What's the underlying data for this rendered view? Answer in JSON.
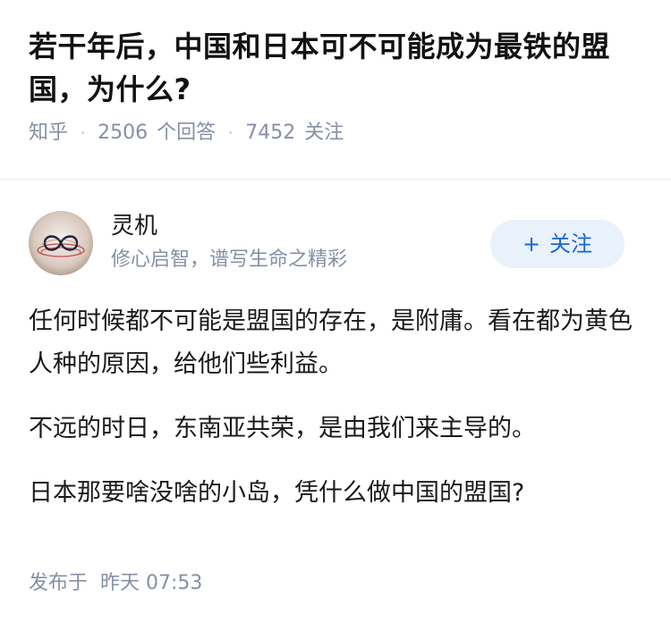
{
  "question": {
    "title": "若干年后，中国和日本可不可能成为最铁的盟国，为什么?",
    "source": "知乎",
    "answer_count": "2506",
    "answer_count_label": "个回答",
    "follow_count": "7452",
    "follow_count_label": "关注"
  },
  "author": {
    "name": "灵机",
    "bio": "修心启智，谱写生命之精彩",
    "avatar_icon": "infinity-logo-avatar",
    "follow_plus": "+",
    "follow_label": "关注"
  },
  "answer": {
    "paragraphs": [
      "任何时候都不可能是盟国的存在，是附庸。看在都为黄色人种的原因，给他们些利益。",
      "不远的时日，东南亚共荣，是由我们来主导的。",
      "日本那要啥没啥的小岛，凭什么做中国的盟国?"
    ],
    "published_label": "发布于",
    "published_time": "昨天 07:53"
  },
  "colors": {
    "muted": "#8590a6",
    "accent": "#1766d6",
    "follow_bg": "#e9f1fb",
    "divider": "#ebebeb"
  }
}
